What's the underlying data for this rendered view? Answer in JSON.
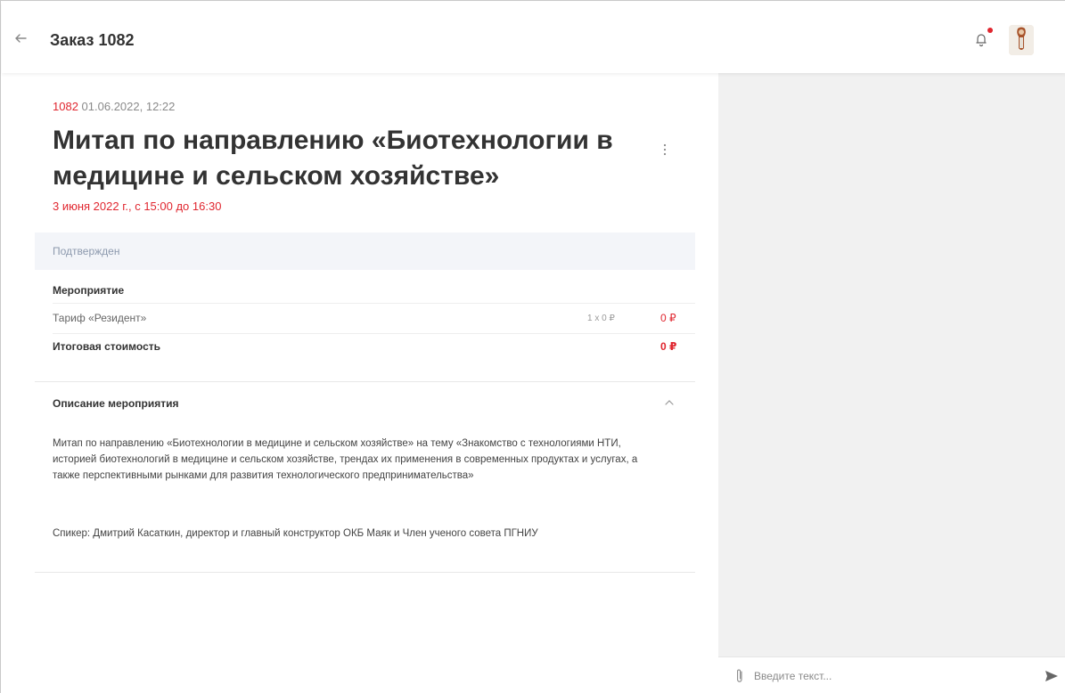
{
  "header": {
    "title": "Заказ 1082"
  },
  "order": {
    "number": "1082",
    "datetime": "01.06.2022, 12:22",
    "title": "Митап по направлению «Биотехнологии в медицине и сельском хозяйстве»",
    "event_date": "3 июня 2022 г., с 15:00 до 16:30",
    "status": "Подтвержден"
  },
  "items": {
    "section_label": "Мероприятие",
    "tariff": {
      "name": "Тариф «Резидент»",
      "qty": "1 x 0 ₽",
      "price": "0 ₽"
    },
    "total_label": "Итоговая стоимость",
    "total_value": "0 ₽"
  },
  "description": {
    "title": "Описание мероприятия",
    "body": "Митап по направлению «Биотехнологии в медицине и сельском хозяйстве» на тему «Знакомство с технологиями НТИ, историей биотехнологий в медицине и сельском хозяйстве, трендах их применения в современных продуктах и услугах, а также перспективными рынками для развития технологического предпринимательства»",
    "speaker": "Спикер: Дмитрий Касаткин, директор и главный конструктор ОКБ Маяк и Член ученого совета ПГНИУ"
  },
  "chat": {
    "placeholder": "Введите текст..."
  },
  "colors": {
    "accent": "#e0262f",
    "status_bg": "#f3f5f9",
    "chat_bg": "#f1f1f1"
  },
  "icons": [
    "arrow-left-icon",
    "bell-icon",
    "kebab-menu-icon",
    "chevron-up-icon",
    "paperclip-icon",
    "send-icon"
  ]
}
